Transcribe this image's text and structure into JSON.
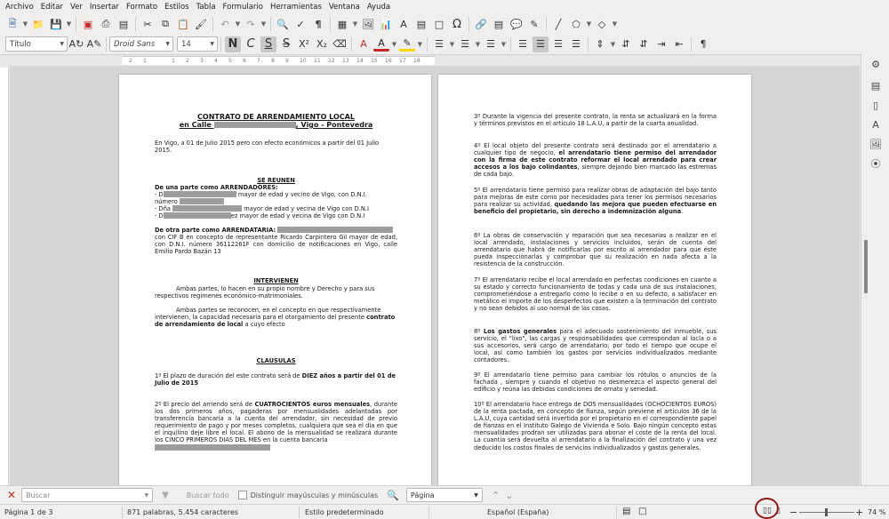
{
  "menu": [
    "Archivo",
    "Editar",
    "Ver",
    "Insertar",
    "Formato",
    "Estilos",
    "Tabla",
    "Formulario",
    "Herramientas",
    "Ventana",
    "Ayuda"
  ],
  "toolbar": {
    "paragraph_style": "Título",
    "font_name": "Droid Sans",
    "font_size": "14",
    "bold_label": "N",
    "italic_label": "C",
    "underline_label": "S",
    "strike_label": "S"
  },
  "ruler_labels": [
    "2",
    "1",
    "1",
    "2",
    "3",
    "4",
    "5",
    "6",
    "7",
    "8",
    "9",
    "10",
    "11",
    "12",
    "13",
    "14",
    "15",
    "16",
    "17",
    "18"
  ],
  "page1": {
    "title1": "CONTRATO DE ARRENDAMIENTO LOCAL",
    "title2a": "en Calle ",
    "title2b": ", Vigo - Pontevedra",
    "intro": "En Vigo,  a 01 de  Julio 2015 pero con efecto económicos a partir del 01 Julio 2015.",
    "se_reunen": "SE REUNEN",
    "parte_arrendadores": "De una parte como ARRENDADORES:",
    "arr1_a": "- D",
    "arr1_b": " mayor de edad y vecino de Vigo, con D.N.I.",
    "arr1_c": "número ",
    "arr2_a": "- Dña ",
    "arr2_b": " mayor de edad y vecina de Vigo con D.N.I",
    "arr3_a": "- D",
    "arr3_b": "ez  mayor de edad y vecina de Vigo con D.N.I",
    "parte_arrendataria": "De otra parte como ARRENDATARIA:",
    "arrendataria_text": "con CIF B          en concepto de representante Ricardo Carpintero Gil mayor de edad, con D.N.I. número 36112261F con domicilio de notificaciones en Vigo, calle Emilio Pardo Bazán 13",
    "intervienen": "INTERVIENEN",
    "interv1": "Ambas partes, lo hacen en su propio nombre y Derecho y para sus respectivos regimenes económico-matrimoniales.",
    "interv2a": "Ambas partes se reconocen, en el concepto en que respectivamente intervienen, la capacidad necesaria para el otorgamiento del presente ",
    "interv2b": "contrato de arrendamiento de local",
    "interv2c": " a cuyo efecto",
    "clausulas": "CLAUSULAS",
    "c1a": "1º  El plazo de duración del este contrato será de ",
    "c1b": "DIEZ años a partir del 01 de Julio de 2015",
    "c2a": "2º El precio del arriendo será de ",
    "c2b": "CUATROCIENTOS euros mensuales",
    "c2c": ", durante los dos primeros años, pagaderas por mensualidades adelantadas por transferencia bancaria a la cuenta del arrendador, sin necesidad de previo requerimiento de pago y por meses completos, cualquiera que sea el día en que el inquilino deje libre el local. El abono de la mensualidad se realizará durante los CINCO PRIMEROS DIAS DEL MES en la cuenta bancaria"
  },
  "page2": {
    "c3": "3º  Durante la vigencia del presente contrato, la renta se actualizará en la forma y términos previstos en el artículo 18 L.A.U, a partir de la cuarta anualidad.",
    "c4a": "4º  El local objeto del presente contrato será destinado por el arrendatario a cualquier tipo de negocio, ",
    "c4b": "el arrendatario tiene permiso del arrendador con la firma de este contrato reformar el local arrendado para crear accesos a los bajo colindantes",
    "c4c": ", siempre dejando bien marcado las estremas de cada bajo.",
    "c5a": "5º  El arrendatario tiene permiso para realizar obras de adaptación del bajo tanto para mejoras de este como por necesidades para tener los permisos necesarios para realizar su actividad, ",
    "c5b": "quedando las mejora que pueden efectuarse en beneficio del propietario, sin derecho a indemnización alguna",
    "c5c": ".",
    "c6": "6º  La obras de conservación y reparación que sea necesarias a realizar en el local arrendado, instalaciones y servicios incluidos, serán de cuenta del arrendatario que habrá de notificarlas por escrito al arrendador para que éste pueda inspeccionarlas y comprobar que su realización en nada afecta a la resistencia de la construcción.",
    "c7": "7º  El arrendatario recibe el local arrendado en perfectas condiciones en cuanto a su estado y correcto funcionamiento de todas y cada una de sus instalaciones, comprometiéndose a entregarlo como lo recibe o en su defecto, a satisfacer en metálico el importe de los desperfectos que existen a la terminación del contrato y no sean debidos al uso normal de las cosas.",
    "c8a": "8º  ",
    "c8b": "Los gastos generales",
    "c8c": " para el adecuado sostenimiento del inmueble, sus servicio, el \"lixo\", las cargas y responsabilidades que correspondan al locla o a sus accesorios, será cargo de arrendatario; por todo el tiempo que ocupe el local, así como también los gastos por servicios individualizados mediante contadores.",
    "c9": "9º  El arrendatario tiene permiso para cambiar los rótulos o anuncios de la fachada , siempre y cuando el objetivo no desmerezca el aspecto general del edificio y reúna las debidas condiciones de ornato y seriedad.",
    "c10": "10º  El arrendatario hace entrega de DOS mensualidades (OCHOCIENTOS EUROS) de la renta pactada, en concepto de fianza, según previene el articulos 36 de la L.A.U, cuya cantidad será invertida por el propietario en el correspondiente papel de fianzas en el Instituto Galego de Vivienda e Solo. Bajo ningún concepto estas mensualidades prodran ser utilizadas para abonar el coste de la renta del local. La cuantía será devuelta al arrendatario a la finalización del contrato y una vez deducido los costos finales de servicios individualizados y gastos generales."
  },
  "findbar": {
    "search_placeholder": "Buscar",
    "find_all": "Buscar todo",
    "match_case": "Distinguir mayúsculas y minúsculas",
    "search_scope": "Página"
  },
  "statusbar": {
    "page": "Página 1 de 3",
    "words": "871 palabras, 5.454 caracteres",
    "style": "Estilo predeterminado",
    "language": "Español (España)",
    "zoom": "74 %"
  },
  "colors": {
    "highlight_circle": "#8b1a1a",
    "font_color": "#c62828",
    "highlight_color": "#f5d800"
  }
}
